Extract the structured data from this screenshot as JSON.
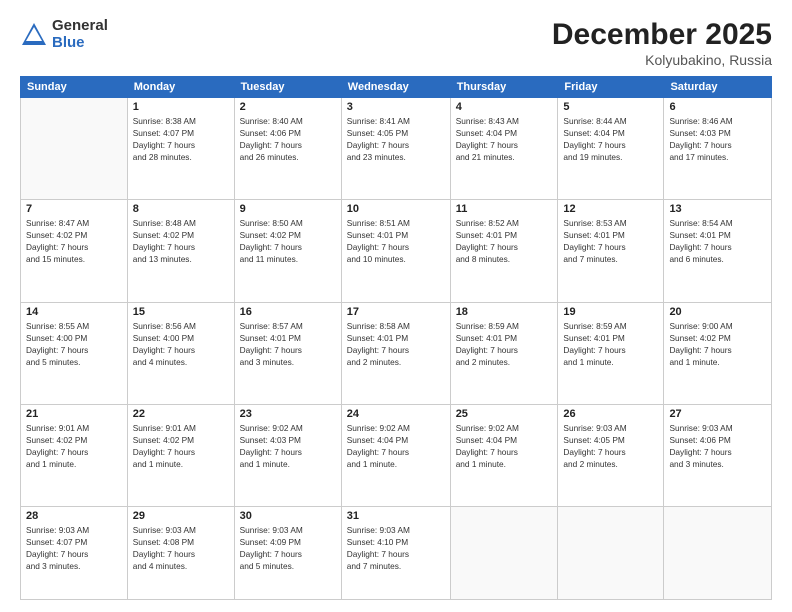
{
  "logo": {
    "general": "General",
    "blue": "Blue"
  },
  "header": {
    "month": "December 2025",
    "location": "Kolyubakino, Russia"
  },
  "weekdays": [
    "Sunday",
    "Monday",
    "Tuesday",
    "Wednesday",
    "Thursday",
    "Friday",
    "Saturday"
  ],
  "weeks": [
    [
      {
        "day": "",
        "info": ""
      },
      {
        "day": "1",
        "info": "Sunrise: 8:38 AM\nSunset: 4:07 PM\nDaylight: 7 hours\nand 28 minutes."
      },
      {
        "day": "2",
        "info": "Sunrise: 8:40 AM\nSunset: 4:06 PM\nDaylight: 7 hours\nand 26 minutes."
      },
      {
        "day": "3",
        "info": "Sunrise: 8:41 AM\nSunset: 4:05 PM\nDaylight: 7 hours\nand 23 minutes."
      },
      {
        "day": "4",
        "info": "Sunrise: 8:43 AM\nSunset: 4:04 PM\nDaylight: 7 hours\nand 21 minutes."
      },
      {
        "day": "5",
        "info": "Sunrise: 8:44 AM\nSunset: 4:04 PM\nDaylight: 7 hours\nand 19 minutes."
      },
      {
        "day": "6",
        "info": "Sunrise: 8:46 AM\nSunset: 4:03 PM\nDaylight: 7 hours\nand 17 minutes."
      }
    ],
    [
      {
        "day": "7",
        "info": "Sunrise: 8:47 AM\nSunset: 4:02 PM\nDaylight: 7 hours\nand 15 minutes."
      },
      {
        "day": "8",
        "info": "Sunrise: 8:48 AM\nSunset: 4:02 PM\nDaylight: 7 hours\nand 13 minutes."
      },
      {
        "day": "9",
        "info": "Sunrise: 8:50 AM\nSunset: 4:02 PM\nDaylight: 7 hours\nand 11 minutes."
      },
      {
        "day": "10",
        "info": "Sunrise: 8:51 AM\nSunset: 4:01 PM\nDaylight: 7 hours\nand 10 minutes."
      },
      {
        "day": "11",
        "info": "Sunrise: 8:52 AM\nSunset: 4:01 PM\nDaylight: 7 hours\nand 8 minutes."
      },
      {
        "day": "12",
        "info": "Sunrise: 8:53 AM\nSunset: 4:01 PM\nDaylight: 7 hours\nand 7 minutes."
      },
      {
        "day": "13",
        "info": "Sunrise: 8:54 AM\nSunset: 4:01 PM\nDaylight: 7 hours\nand 6 minutes."
      }
    ],
    [
      {
        "day": "14",
        "info": "Sunrise: 8:55 AM\nSunset: 4:00 PM\nDaylight: 7 hours\nand 5 minutes."
      },
      {
        "day": "15",
        "info": "Sunrise: 8:56 AM\nSunset: 4:00 PM\nDaylight: 7 hours\nand 4 minutes."
      },
      {
        "day": "16",
        "info": "Sunrise: 8:57 AM\nSunset: 4:01 PM\nDaylight: 7 hours\nand 3 minutes."
      },
      {
        "day": "17",
        "info": "Sunrise: 8:58 AM\nSunset: 4:01 PM\nDaylight: 7 hours\nand 2 minutes."
      },
      {
        "day": "18",
        "info": "Sunrise: 8:59 AM\nSunset: 4:01 PM\nDaylight: 7 hours\nand 2 minutes."
      },
      {
        "day": "19",
        "info": "Sunrise: 8:59 AM\nSunset: 4:01 PM\nDaylight: 7 hours\nand 1 minute."
      },
      {
        "day": "20",
        "info": "Sunrise: 9:00 AM\nSunset: 4:02 PM\nDaylight: 7 hours\nand 1 minute."
      }
    ],
    [
      {
        "day": "21",
        "info": "Sunrise: 9:01 AM\nSunset: 4:02 PM\nDaylight: 7 hours\nand 1 minute."
      },
      {
        "day": "22",
        "info": "Sunrise: 9:01 AM\nSunset: 4:02 PM\nDaylight: 7 hours\nand 1 minute."
      },
      {
        "day": "23",
        "info": "Sunrise: 9:02 AM\nSunset: 4:03 PM\nDaylight: 7 hours\nand 1 minute."
      },
      {
        "day": "24",
        "info": "Sunrise: 9:02 AM\nSunset: 4:04 PM\nDaylight: 7 hours\nand 1 minute."
      },
      {
        "day": "25",
        "info": "Sunrise: 9:02 AM\nSunset: 4:04 PM\nDaylight: 7 hours\nand 1 minute."
      },
      {
        "day": "26",
        "info": "Sunrise: 9:03 AM\nSunset: 4:05 PM\nDaylight: 7 hours\nand 2 minutes."
      },
      {
        "day": "27",
        "info": "Sunrise: 9:03 AM\nSunset: 4:06 PM\nDaylight: 7 hours\nand 3 minutes."
      }
    ],
    [
      {
        "day": "28",
        "info": "Sunrise: 9:03 AM\nSunset: 4:07 PM\nDaylight: 7 hours\nand 3 minutes."
      },
      {
        "day": "29",
        "info": "Sunrise: 9:03 AM\nSunset: 4:08 PM\nDaylight: 7 hours\nand 4 minutes."
      },
      {
        "day": "30",
        "info": "Sunrise: 9:03 AM\nSunset: 4:09 PM\nDaylight: 7 hours\nand 5 minutes."
      },
      {
        "day": "31",
        "info": "Sunrise: 9:03 AM\nSunset: 4:10 PM\nDaylight: 7 hours\nand 7 minutes."
      },
      {
        "day": "",
        "info": ""
      },
      {
        "day": "",
        "info": ""
      },
      {
        "day": "",
        "info": ""
      }
    ]
  ]
}
